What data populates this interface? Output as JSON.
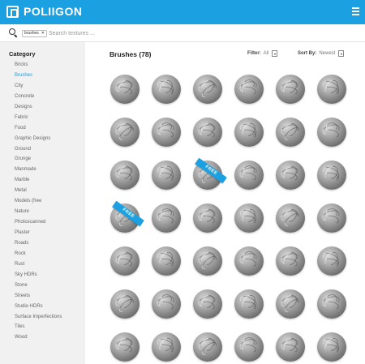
{
  "brand": {
    "name": "POLIIGON"
  },
  "search": {
    "tag": "brushes",
    "placeholder": "Search textures ..."
  },
  "sidebar": {
    "heading": "Category",
    "items": [
      "Bricks",
      "Brushes",
      "City",
      "Concrete",
      "Designs",
      "Fabric",
      "Food",
      "Graphic Designs",
      "Ground",
      "Grunge",
      "Manmade",
      "Marble",
      "Metal",
      "Models (free",
      "Nature",
      "Photoscanned",
      "Plaster",
      "Roads",
      "Rock",
      "Rust",
      "Sky HDRs",
      "Stone",
      "Streets",
      "Studio HDRs",
      "Surface Imperfections",
      "Tiles",
      "Wood"
    ],
    "active_index": 1
  },
  "main": {
    "title": "Brushes (78)",
    "filter": {
      "label": "Filter:",
      "value": "All"
    },
    "sort": {
      "label": "Sort By:",
      "value": "Newest"
    },
    "free_label": "FREE",
    "grid": {
      "columns": 6,
      "rows": 7,
      "free_items": [
        14,
        18
      ]
    }
  },
  "colors": {
    "brand_blue": "#1ba0e1",
    "sidebar_bg": "#f1f1f1"
  },
  "icons": {
    "search": "search-icon",
    "menu": "hamburger-menu-icon",
    "logo": "poliigon-logo-icon"
  }
}
